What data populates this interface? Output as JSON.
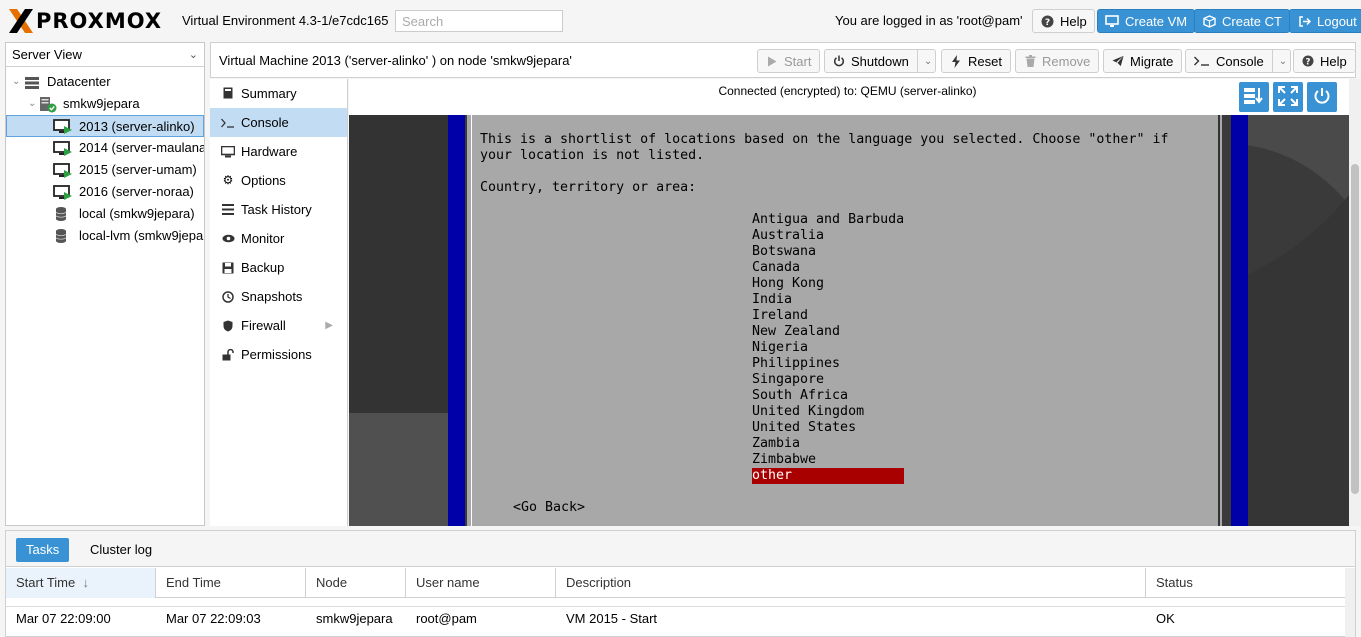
{
  "topbar": {
    "logo": "PROXMOX",
    "version": "Virtual Environment 4.3-1/e7cdc165",
    "search_placeholder": "Search",
    "logged_in": "You are logged in as 'root@pam'",
    "help": "Help",
    "create_vm": "Create VM",
    "create_ct": "Create CT",
    "logout": "Logout",
    "accent": "#3892d4"
  },
  "tree": {
    "view": "Server View",
    "nodes": [
      {
        "label": "Datacenter",
        "icon": "datacenter-icon"
      },
      {
        "label": "smkw9jepara",
        "icon": "node-icon"
      },
      {
        "label": "2013 (server-alinko)",
        "icon": "vm-running-icon",
        "selected": true
      },
      {
        "label": "2014 (server-maulana",
        "icon": "vm-running-icon"
      },
      {
        "label": "2015 (server-umam)",
        "icon": "vm-running-icon"
      },
      {
        "label": "2016 (server-noraa)",
        "icon": "vm-running-icon"
      },
      {
        "label": "local (smkw9jepara)",
        "icon": "storage-icon"
      },
      {
        "label": "local-lvm (smkw9jepa",
        "icon": "storage-icon"
      }
    ]
  },
  "main": {
    "title": "Virtual Machine 2013 ('server-alinko' ) on node 'smkw9jepara'",
    "buttons": {
      "start": "Start",
      "shutdown": "Shutdown",
      "reset": "Reset",
      "remove": "Remove",
      "migrate": "Migrate",
      "console": "Console",
      "help": "Help"
    },
    "nav": [
      {
        "label": "Summary",
        "icon": "book-icon"
      },
      {
        "label": "Console",
        "icon": "terminal-icon",
        "selected": true
      },
      {
        "label": "Hardware",
        "icon": "monitor-icon"
      },
      {
        "label": "Options",
        "icon": "gear-icon"
      },
      {
        "label": "Task History",
        "icon": "list-icon"
      },
      {
        "label": "Monitor",
        "icon": "eye-icon"
      },
      {
        "label": "Backup",
        "icon": "floppy-icon"
      },
      {
        "label": "Snapshots",
        "icon": "history-icon"
      },
      {
        "label": "Firewall",
        "icon": "shield-icon",
        "has_submenu": true
      },
      {
        "label": "Permissions",
        "icon": "unlock-icon"
      }
    ],
    "console": {
      "status": "Connected (encrypted) to: QEMU (server-alinko)",
      "intro_line1": "This is a shortlist of locations based on the language you selected. Choose \"other\" if",
      "intro_line2": "your location is not listed.",
      "prompt": "Country, territory or area:",
      "countries": [
        "Antigua and Barbuda",
        "Australia",
        "Botswana",
        "Canada",
        "Hong Kong",
        "India",
        "Ireland",
        "New Zealand",
        "Nigeria",
        "Philippines",
        "Singapore",
        "South Africa",
        "United Kingdom",
        "United States",
        "Zambia",
        "Zimbabwe"
      ],
      "selected_option": "other",
      "go_back": "<Go Back>",
      "highlight_color": "#a80000"
    }
  },
  "bottom": {
    "tabs": [
      "Tasks",
      "Cluster log"
    ],
    "columns": [
      "Start Time",
      "End Time",
      "Node",
      "User name",
      "Description",
      "Status"
    ],
    "rows": [
      {
        "start": "Mar 07 22:09:00",
        "end": "Mar 07 22:09:03",
        "node": "smkw9jepara",
        "user": "root@pam",
        "description": "VM 2015 - Start",
        "status": "OK"
      }
    ]
  }
}
